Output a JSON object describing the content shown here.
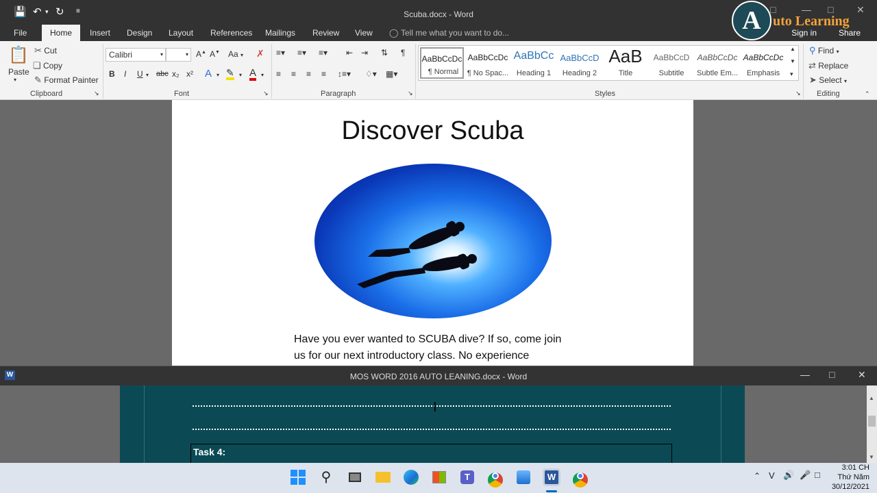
{
  "window1": {
    "title": "Scuba.docx  -  Word",
    "tabs": [
      "File",
      "Home",
      "Insert",
      "Design",
      "Layout",
      "References",
      "Mailings",
      "Review",
      "View"
    ],
    "tell_me": "Tell me what you want to do...",
    "sign_in": "Sign in",
    "share": "Share"
  },
  "logo": {
    "letter": "A",
    "text": "uto Learning"
  },
  "ribbon": {
    "clipboard": {
      "paste": "Paste",
      "cut": "Cut",
      "copy": "Copy",
      "format_painter": "Format Painter",
      "label": "Clipboard"
    },
    "font": {
      "name": "Calibri",
      "size": "",
      "bold": "B",
      "italic": "I",
      "underline": "U",
      "strike": "abc",
      "sub": "x₂",
      "sup": "x²",
      "case": "Aa",
      "label": "Font"
    },
    "paragraph": {
      "label": "Paragraph"
    },
    "styles": {
      "label": "Styles",
      "items": [
        {
          "sample": "AaBbCcDc",
          "name": "¶ Normal"
        },
        {
          "sample": "AaBbCcDc",
          "name": "¶ No Spac..."
        },
        {
          "sample": "AaBbCc",
          "name": "Heading 1"
        },
        {
          "sample": "AaBbCcD",
          "name": "Heading 2"
        },
        {
          "sample": "AaB",
          "name": "Title"
        },
        {
          "sample": "AaBbCcD",
          "name": "Subtitle"
        },
        {
          "sample": "AaBbCcDc",
          "name": "Subtle Em..."
        },
        {
          "sample": "AaBbCcDc",
          "name": "Emphasis"
        }
      ]
    },
    "editing": {
      "find": "Find",
      "replace": "Replace",
      "select": "Select",
      "label": "Editing"
    }
  },
  "document1": {
    "heading": "Discover Scuba",
    "paragraph": "Have you ever wanted to SCUBA dive?  If so, come join us for our next introductory class.  No experience"
  },
  "window2": {
    "title": "MOS WORD 2016 AUTO LEANING.docx  -  Word",
    "task_label": "Task 4:"
  },
  "taskbar": {
    "time": "3:01 CH",
    "day": "Thứ Năm",
    "date": "30/12/2021"
  },
  "colors": {
    "title_bar": "#323232",
    "ribbon": "#f3f3f3",
    "doc_bg": "#696969",
    "page2_bg": "#0b4a54",
    "logo_text": "#f2a33a"
  }
}
